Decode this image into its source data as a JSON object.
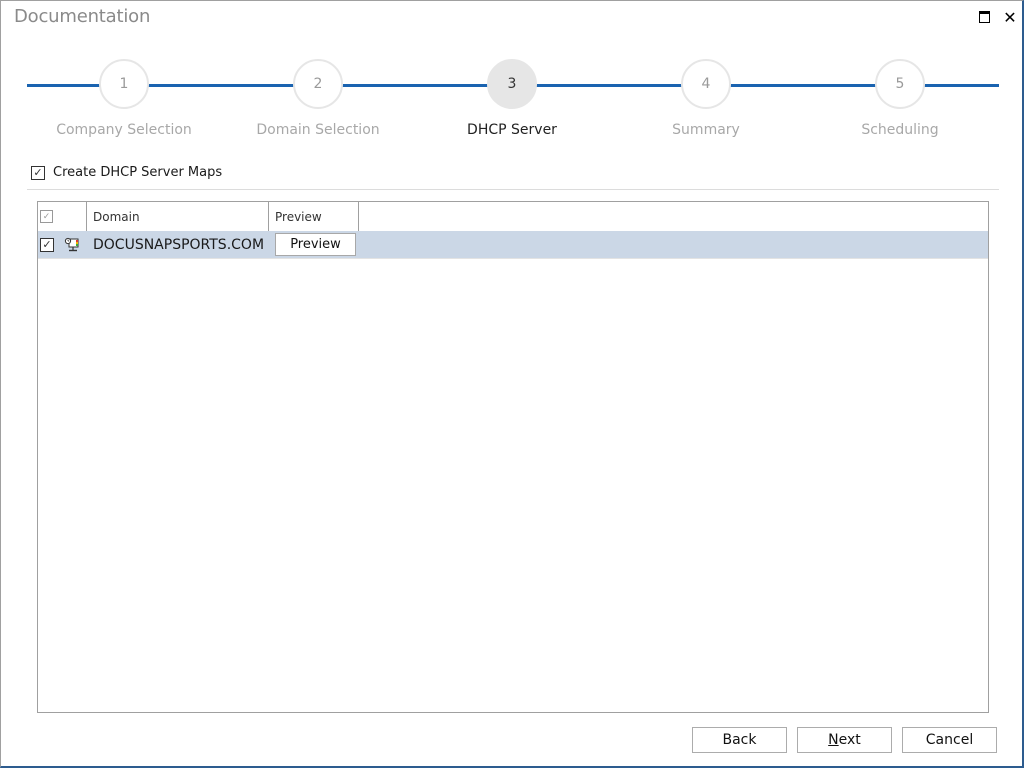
{
  "window": {
    "title": "Documentation",
    "maximize_label": "Maximize",
    "close_label": "✕"
  },
  "stepper": {
    "current_step": 3,
    "steps": [
      {
        "number": "1",
        "label": "Company Selection",
        "state": "inactive"
      },
      {
        "number": "2",
        "label": "Domain Selection",
        "state": "inactive"
      },
      {
        "number": "3",
        "label": "DHCP Server",
        "state": "active"
      },
      {
        "number": "4",
        "label": "Summary",
        "state": "inactive"
      },
      {
        "number": "5",
        "label": "Scheduling",
        "state": "inactive"
      }
    ],
    "line_color": "#1a63b0"
  },
  "options": {
    "create_maps_label": "Create DHCP Server Maps",
    "create_maps_checked": true
  },
  "grid": {
    "header_checkbox_checked": true,
    "columns": [
      "Domain",
      "Preview"
    ],
    "rows": [
      {
        "checked": true,
        "icon": "dhcp-server-icon",
        "domain": "DOCUSNAPSPORTS.COM",
        "preview_button": "Preview",
        "selected": true
      }
    ],
    "selected_row_color": "#cbd7e6"
  },
  "footer": {
    "back_label": "Back",
    "next_label_prefix": "N",
    "next_label_rest": "ext",
    "cancel_label": "Cancel"
  },
  "glyphs": {
    "check": "✓"
  }
}
